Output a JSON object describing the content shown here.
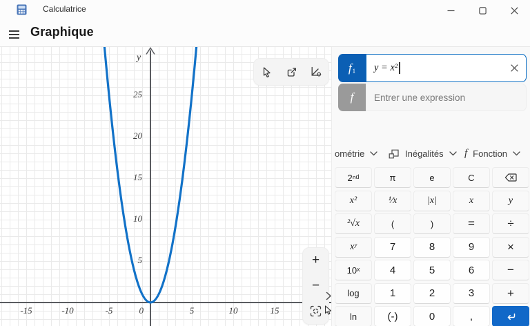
{
  "window": {
    "title": "Calculatrice",
    "app_icon": "calculator-app-icon",
    "controls": {
      "minimize": "minimize-icon",
      "maximize": "maximize-icon",
      "close": "close-icon"
    }
  },
  "header": {
    "menu_icon": "hamburger-icon",
    "title": "Graphique"
  },
  "graph": {
    "toolbar_icons": [
      "trace-pointer-icon",
      "share-icon",
      "graph-options-icon"
    ],
    "zoom_controls": {
      "zoom_in": "+",
      "zoom_out": "−",
      "fit_icon": "fit-view-icon"
    },
    "panel_toggle_icon": "chevron-right-icon",
    "mouse_cursor": "pointer-cursor",
    "y_axis_label": "y",
    "y_ticks": [
      "25",
      "20",
      "15",
      "10",
      "5"
    ],
    "x_ticks": [
      "-15",
      "-10",
      "-5",
      "0",
      "5",
      "10",
      "15"
    ],
    "chart_data": {
      "type": "line",
      "functions": [
        {
          "expression": "y = x²",
          "color": "#1272c8"
        }
      ],
      "x_range": [
        -18.2,
        21.8
      ],
      "y_range": [
        -2.8,
        30.8
      ],
      "grid": true,
      "grid_step": 1,
      "label_step": 5,
      "axis_color": "#5a5c60"
    }
  },
  "panel": {
    "functions": [
      {
        "badge": "f",
        "badge_sub": "1",
        "value": "y = x²",
        "focused": true,
        "clear_icon": "clear-icon",
        "badge_color": "#0b5fb4",
        "focus_border": "#0067c0"
      },
      {
        "badge": "f",
        "placeholder": "Entrer une expression",
        "badge_color": "#9a9a9a"
      }
    ],
    "tabs": [
      {
        "label": "ométrie",
        "chevron_icon": "chevron-down-icon"
      },
      {
        "label": "Inégalités",
        "icon": "inequalities-icon",
        "chevron_icon": "chevron-down-icon"
      },
      {
        "label": "Fonction",
        "icon_text": "f",
        "chevron_icon": "chevron-down-icon"
      }
    ]
  },
  "keypad": {
    "enter_color": "#1168c8",
    "rows": [
      {
        "keys": [
          {
            "label": "2ⁿᵈ"
          },
          {
            "label": "π"
          },
          {
            "label": "e"
          },
          {
            "label": "C"
          },
          {
            "label": "",
            "icon": "backspace-icon"
          }
        ]
      },
      {
        "keys": [
          {
            "label": "x²"
          },
          {
            "label": "¹⁄x"
          },
          {
            "label": "|x|"
          },
          {
            "label": "x"
          },
          {
            "label": "y"
          }
        ]
      },
      {
        "keys": [
          {
            "label": "²√x"
          },
          {
            "label": "("
          },
          {
            "label": ")"
          },
          {
            "label": "="
          },
          {
            "label": "÷"
          }
        ]
      },
      {
        "keys": [
          {
            "label": "xʸ"
          },
          {
            "label": "7"
          },
          {
            "label": "8"
          },
          {
            "label": "9"
          },
          {
            "label": "×"
          }
        ]
      },
      {
        "keys": [
          {
            "label": "10ˣ"
          },
          {
            "label": "4"
          },
          {
            "label": "5"
          },
          {
            "label": "6"
          },
          {
            "label": "−"
          }
        ]
      },
      {
        "keys": [
          {
            "label": "log"
          },
          {
            "label": "1"
          },
          {
            "label": "2"
          },
          {
            "label": "3"
          },
          {
            "label": "+"
          }
        ]
      },
      {
        "keys": [
          {
            "label": "ln"
          },
          {
            "label": "(-)"
          },
          {
            "label": "0"
          },
          {
            "label": ","
          },
          {
            "label": "",
            "icon": "enter-icon"
          }
        ]
      }
    ]
  }
}
